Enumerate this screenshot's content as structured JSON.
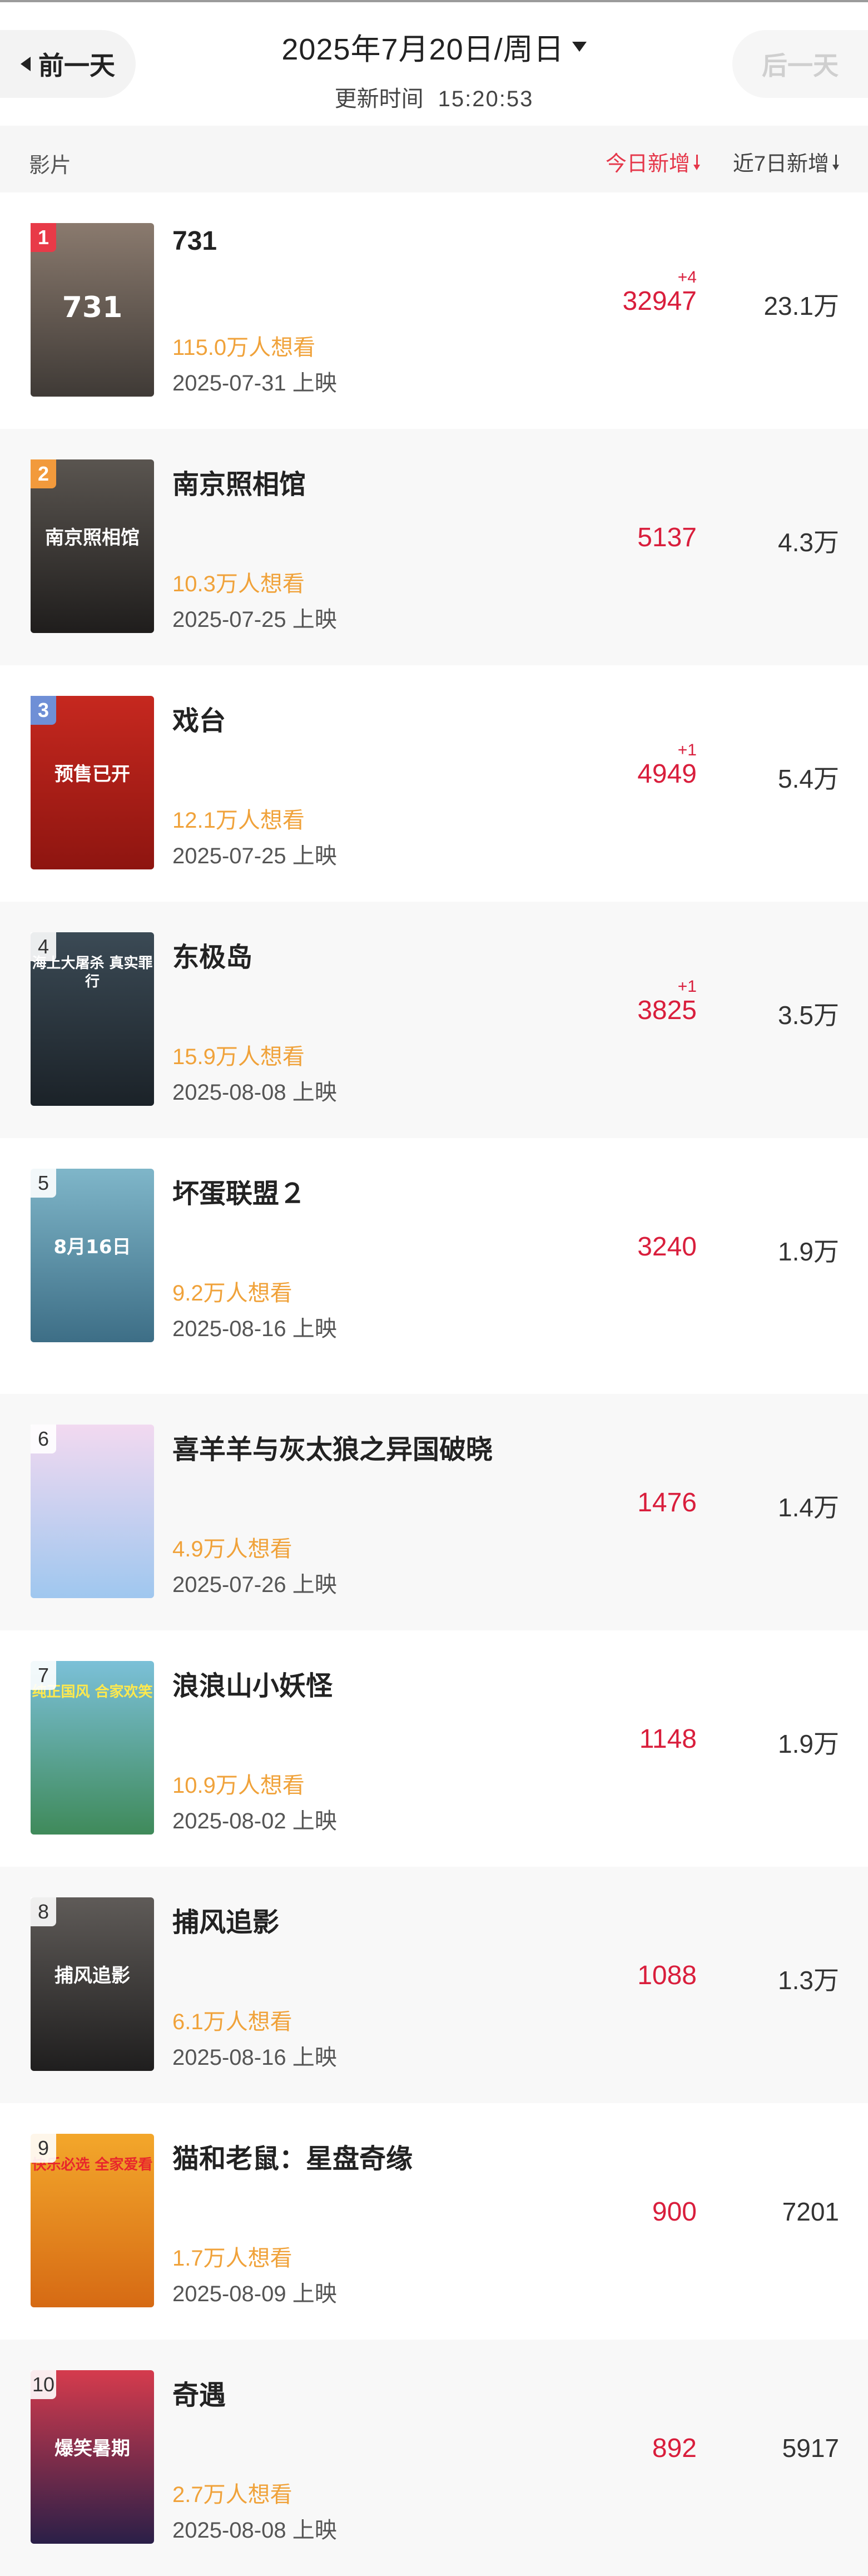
{
  "header": {
    "prev_label": "前一天",
    "next_label": "后一天",
    "date": "2025年7月20日/周日",
    "update_label": "更新时间",
    "update_time": "15:20:53"
  },
  "columns": {
    "film": "影片",
    "today": "今日新增",
    "week": "近7日新增"
  },
  "films": [
    {
      "rank": "1",
      "title": "731",
      "want": "115.0万人想看",
      "release": "2025-07-31 上映",
      "today_delta": "+4",
      "today": "32947",
      "week": "23.1万",
      "rank_color": "#e83a48",
      "poster_text": "731"
    },
    {
      "rank": "2",
      "title": "南京照相馆",
      "want": "10.3万人想看",
      "release": "2025-07-25 上映",
      "today_delta": "",
      "today": "5137",
      "week": "4.3万",
      "rank_color": "#f29a3c",
      "poster_text": "南京照相馆"
    },
    {
      "rank": "3",
      "title": "戏台",
      "want": "12.1万人想看",
      "release": "2025-07-25 上映",
      "today_delta": "+1",
      "today": "4949",
      "week": "5.4万",
      "rank_color": "#6f8fd6",
      "poster_text": "预售已开"
    },
    {
      "rank": "4",
      "title": "东极岛",
      "want": "15.9万人想看",
      "release": "2025-08-08 上映",
      "today_delta": "+1",
      "today": "3825",
      "week": "3.5万",
      "rank_color": "",
      "poster_text": "海上大屠杀 真实罪行"
    },
    {
      "rank": "5",
      "title": "坏蛋联盟２",
      "want": "9.2万人想看",
      "release": "2025-08-16 上映",
      "today_delta": "",
      "today": "3240",
      "week": "1.9万",
      "rank_color": "",
      "poster_text": "8月16日"
    },
    {
      "rank": "6",
      "title": "喜羊羊与灰太狼之异国破晓",
      "want": "4.9万人想看",
      "release": "2025-07-26 上映",
      "today_delta": "",
      "today": "1476",
      "week": "1.4万",
      "rank_color": "",
      "poster_text": ""
    },
    {
      "rank": "7",
      "title": "浪浪山小妖怪",
      "want": "10.9万人想看",
      "release": "2025-08-02 上映",
      "today_delta": "",
      "today": "1148",
      "week": "1.9万",
      "rank_color": "",
      "poster_text": "纯正国风 合家欢笑"
    },
    {
      "rank": "8",
      "title": "捕风追影",
      "want": "6.1万人想看",
      "release": "2025-08-16 上映",
      "today_delta": "",
      "today": "1088",
      "week": "1.3万",
      "rank_color": "",
      "poster_text": "捕风追影"
    },
    {
      "rank": "9",
      "title": "猫和老鼠：星盘奇缘",
      "want": "1.7万人想看",
      "release": "2025-08-09 上映",
      "today_delta": "",
      "today": "900",
      "week": "7201",
      "rank_color": "",
      "poster_text": "快乐必选 全家爱看"
    },
    {
      "rank": "10",
      "title": "奇遇",
      "want": "2.7万人想看",
      "release": "2025-08-08 上映",
      "today_delta": "",
      "today": "892",
      "week": "5917",
      "rank_color": "",
      "poster_text": "爆笑暑期"
    }
  ],
  "poster_colors": [
    [
      "#8a7a6e",
      "#3f3a36"
    ],
    [
      "#5a5550",
      "#1f1d1c"
    ],
    [
      "#c6281f",
      "#8e1510"
    ],
    [
      "#3b4a55",
      "#1b2228"
    ],
    [
      "#7fb6c9",
      "#3d6e86"
    ],
    [
      "#f2d9f0",
      "#9fc7ef"
    ],
    [
      "#7bc0d8",
      "#3f8a5a"
    ],
    [
      "#5f5b58",
      "#1f1e1e"
    ],
    [
      "#f3a72b",
      "#d66a14"
    ],
    [
      "#d53b4d",
      "#2a1f48"
    ]
  ]
}
